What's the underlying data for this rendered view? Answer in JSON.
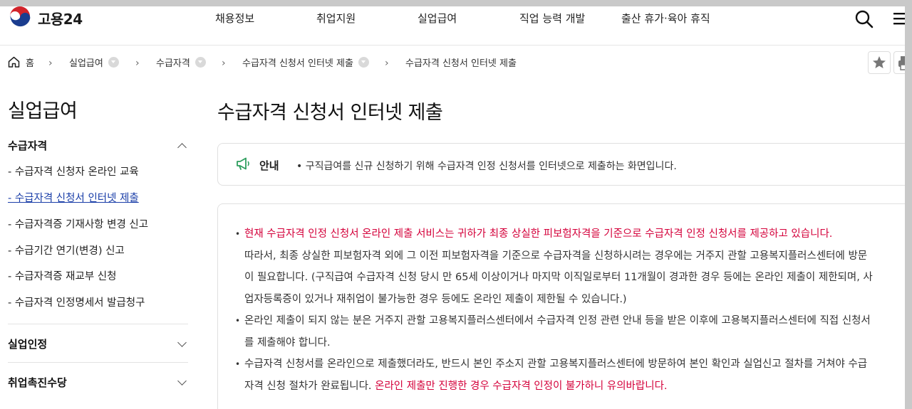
{
  "header": {
    "logo_text": "고용24",
    "nav": [
      "채용정보",
      "취업지원",
      "실업급여",
      "직업 능력 개발",
      "출산 휴가·육아 휴직"
    ]
  },
  "breadcrumb": {
    "home": "홈",
    "items": [
      "실업급여",
      "수급자격",
      "수급자격 신청서 인터넷 제출",
      "수급자격 신청서 인터넷 제출"
    ]
  },
  "sidebar": {
    "title": "실업급여",
    "sections": [
      {
        "label": "수급자격",
        "items": [
          "- 수급자격 신청자 온라인 교육",
          "- 수급자격 신청서 인터넷 제출",
          "- 수급자격증 기재사항 변경 신고",
          "- 수급기간 연기(변경) 신고",
          "- 수급자격증 재교부 신청",
          "- 수급자격 인정명세서 발급청구"
        ],
        "active_index": 1
      },
      {
        "label": "실업인정"
      },
      {
        "label": "취업촉진수당"
      }
    ]
  },
  "main": {
    "title": "수급자격 신청서 인터넷 제출",
    "notice": {
      "label": "안내",
      "text": "• 구직급여를 신규 신청하기 위해 수급자격 인정 신청서를 인터넷으로 제출하는 화면입니다."
    },
    "content": {
      "p1_red": "현재 수급자격 인정 신청서 온라인 제출 서비스는 귀하가 최종 상실한 피보험자격을 기준으로 수급자격 인정 신청서를 제공하고 있습니다.",
      "p1_line1": "따라서, 최종 상실한 피보험자격 외에 그 이전 피보험자격을 기준으로 수급자격을 신청하시려는 경우에는 거주지 관할 고용복지플러스센터에 방문",
      "p1_line2": "이 필요합니다. (구직급여 수급자격 신청 당시 만 65세 이상이거나 마지막 이직일로부터 11개월이 경과한 경우 등에는 온라인 제출이 제한되며, 사",
      "p1_line3": "업자등록증이 있거나 재취업이 불가능한 경우 등에도 온라인 제출이 제한될 수 있습니다.)",
      "p2_line1": "온라인 제출이 되지 않는 분은 거주지 관할 고용복지플러스센터에서 수급자격 인정 관련 안내 등을 받은 이후에 고용복지플러스센터에 직접 신청서",
      "p2_line2": "를 제출해야 합니다.",
      "p3_line1": "수급자격 신청서를 온라인으로 제출했더라도, 반드시 본인 주소지 관할 고용복지플러스센터에 방문하여 본인 확인과 실업신고 절차를 거쳐야 수급",
      "p3_line2": "자격 신청 절차가 완료됩니다.",
      "p3_red": "온라인 제출만 진행한 경우 수급자격 인정이 불가하니 유의바랍니다."
    }
  },
  "colors": {
    "accent_red": "#d4003a",
    "link_blue": "#1a3ea8",
    "notice_green": "#2e9e5e"
  }
}
